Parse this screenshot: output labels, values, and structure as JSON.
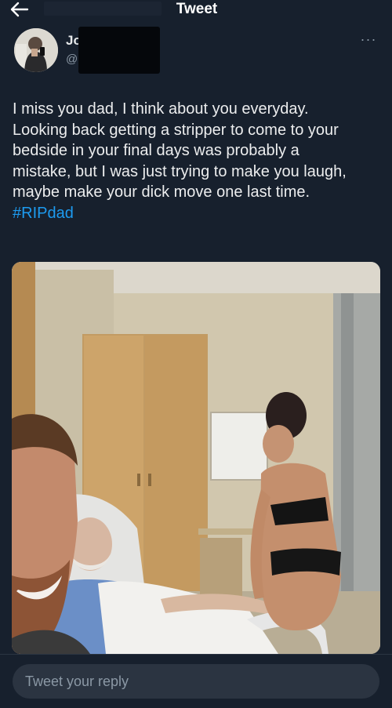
{
  "header": {
    "title": "Tweet",
    "back_icon": "arrow-left-icon"
  },
  "author": {
    "name": "Jo",
    "handle": "@",
    "more_icon": "more-horizontal-icon"
  },
  "tweet": {
    "lines": [
      "I miss you dad, I think about you everyday.",
      "Looking back getting a stripper to come to your",
      "bedside in your final days was probably a",
      "mistake, but I was just trying to make you laugh,",
      "maybe make your dick move one last time."
    ],
    "hashtag": "#RIPdad"
  },
  "reply": {
    "placeholder": "Tweet your reply"
  },
  "colors": {
    "background": "#17202d",
    "link": "#1d9bf0",
    "reply_field": "#2b3441"
  }
}
